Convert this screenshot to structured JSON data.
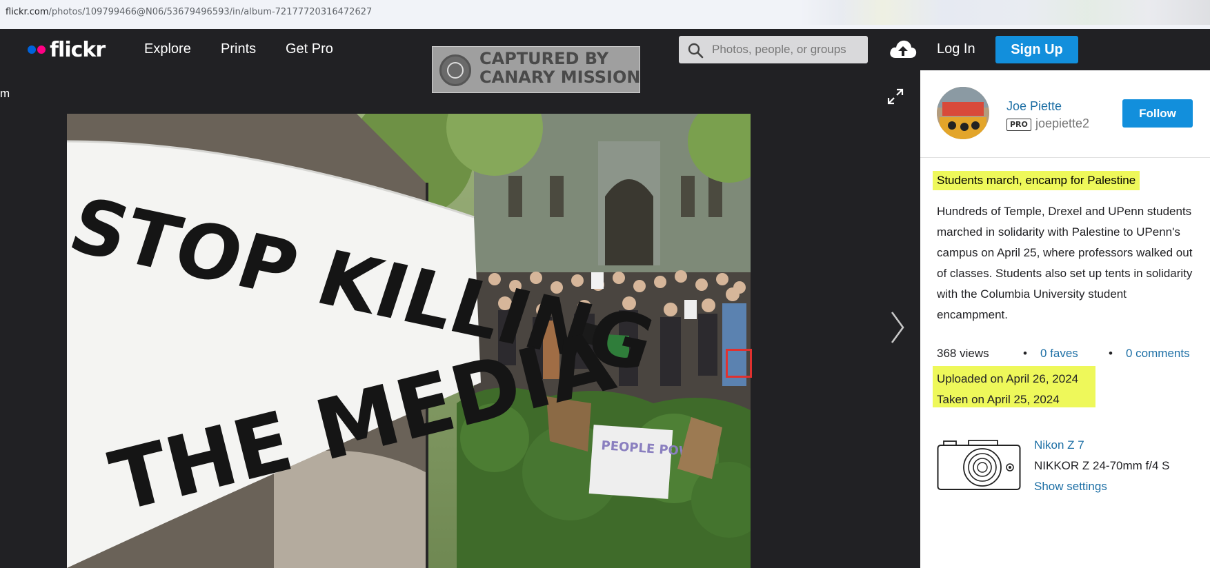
{
  "browser": {
    "url_host": "flickr.com",
    "url_path": "/photos/109799466@N06/53679496593/in/album-72177720316472627"
  },
  "nav": {
    "logo_text": "flickr",
    "links": [
      "Explore",
      "Prints",
      "Get Pro"
    ],
    "search_placeholder": "Photos, people, or groups",
    "login": "Log In",
    "signup": "Sign Up"
  },
  "watermark": {
    "line1": "CAPTURED BY",
    "line2": "CANARY MISSION"
  },
  "stage": {
    "left_label": "m"
  },
  "photo": {
    "banner_line1": "STOP KILLING",
    "banner_line2": "THE MEDIA",
    "sign_text": "PEOPLE POWER"
  },
  "owner": {
    "name": "Joe Piette",
    "pro_badge": "PRO",
    "username": "joepiette2",
    "follow_label": "Follow"
  },
  "details": {
    "title": "Students march, encamp for Palestine",
    "description": "Hundreds of Temple, Drexel and UPenn students marched in solidarity with Palestine to UPenn's campus on April 25, where professors walked out of classes. Students also set up tents in solidarity with the Columbia University student encampment.",
    "views": "368 views",
    "bullet": "•",
    "faves": "0 faves",
    "comments": "0 comments",
    "uploaded": "Uploaded on April 26, 2024",
    "taken": "Taken on April 25, 2024"
  },
  "camera": {
    "model": "Nikon Z 7",
    "lens": "NIKKOR Z 24-70mm f/4 S",
    "settings_link": "Show settings"
  },
  "colors": {
    "nav_bg": "#212124",
    "accent_blue": "#128fdc",
    "link_blue": "#1d6fa5",
    "highlight": "#eef85a",
    "annotation_red": "#e0312f"
  }
}
